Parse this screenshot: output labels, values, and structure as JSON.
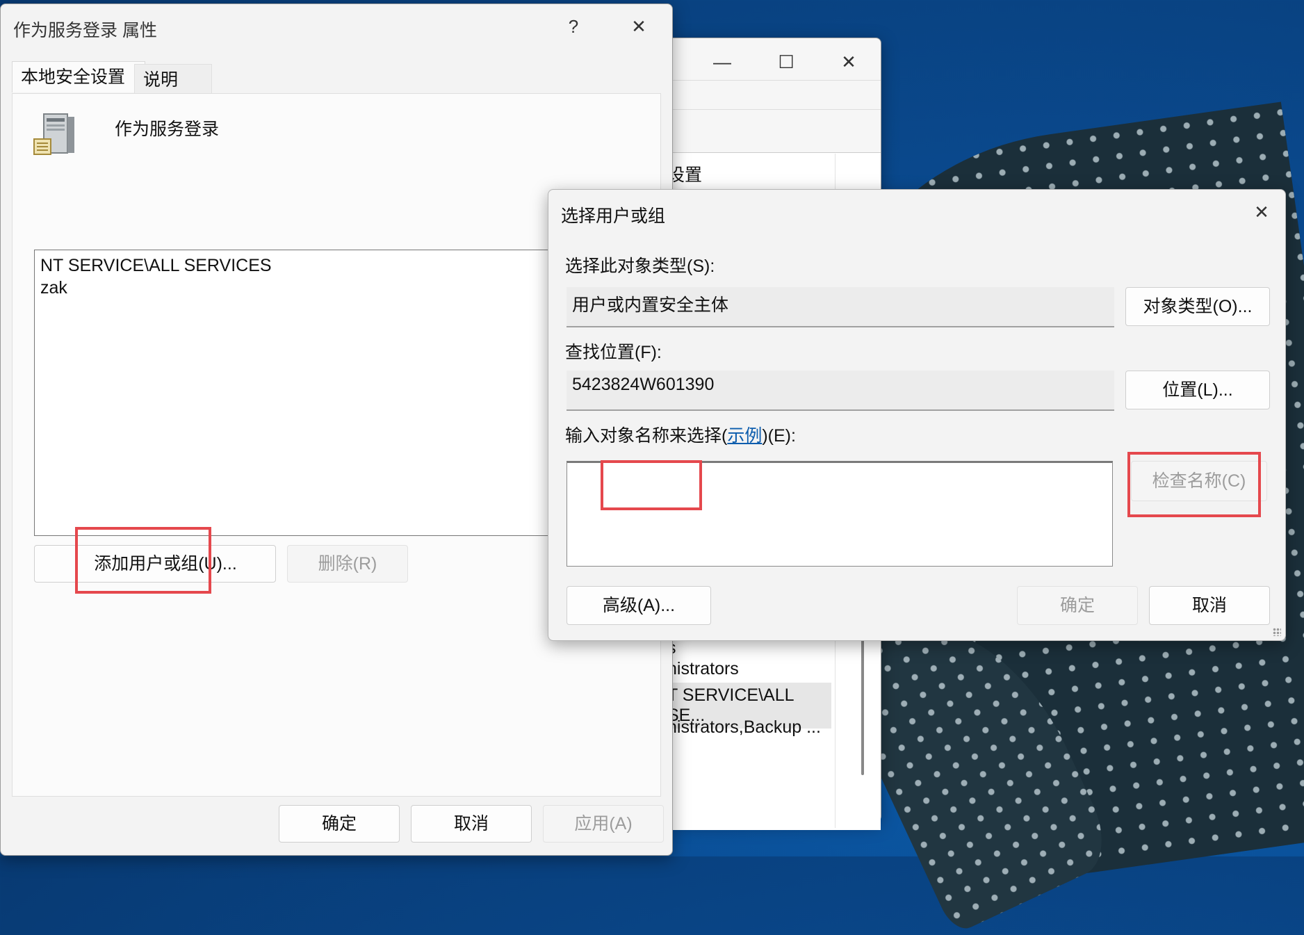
{
  "background_window": {
    "list_header": "设置",
    "list_items": [
      "nistrators",
      "T SERVICE\\ALL SE...",
      "nistrators,Backup ..."
    ],
    "partial_glyph": "s"
  },
  "props_dialog": {
    "title": "作为服务登录 属性",
    "tabs": [
      "本地安全设置",
      "说明"
    ],
    "policy_name": "作为服务登录",
    "icon": "server-icon",
    "members": [
      "NT SERVICE\\ALL SERVICES",
      "zak"
    ],
    "add_button": "添加用户或组(U)...",
    "remove_button": "删除(R)",
    "ok_button": "确定",
    "cancel_button": "取消",
    "apply_button": "应用(A)"
  },
  "select_dialog": {
    "title": "选择用户或组",
    "object_type_label": "选择此对象类型(S):",
    "object_type_value": "用户或内置安全主体",
    "object_types_button": "对象类型(O)...",
    "location_label": "查找位置(F):",
    "location_value": "5423824W601390",
    "location_button": "位置(L)...",
    "names_label_prefix": "输入对象名称来选择(",
    "names_label_link": "示例",
    "names_label_suffix": ")(E):",
    "names_input_value": "",
    "check_names_button": "检查名称(C)",
    "advanced_button": "高级(A)...",
    "ok_button": "确定",
    "cancel_button": "取消"
  },
  "colors": {
    "highlight_red": "#e5484d",
    "link_blue": "#0b5cad"
  }
}
